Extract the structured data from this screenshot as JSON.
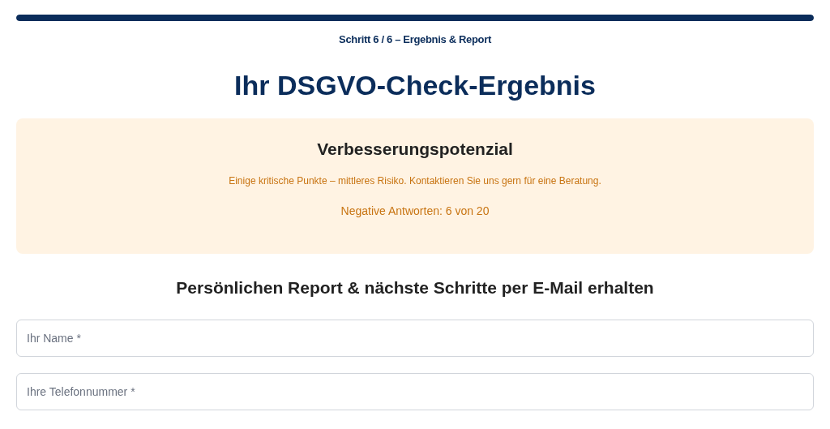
{
  "progress": {
    "level": 1,
    "label": "Schritt 6 / 6 – Ergebnis & Report"
  },
  "title": "Ihr DSGVO-Check-Ergebnis",
  "result": {
    "heading": "Verbesserungspotenzial",
    "message": "Einige kritische Punkte – mittleres Risiko. Kontaktieren Sie uns gern für eine Beratung.",
    "count": "Negative Antworten: 6 von 20"
  },
  "form": {
    "heading": "Persönlichen Report & nächste Schritte per E-Mail erhalten",
    "fields": [
      {
        "placeholder": "Ihr Name *"
      },
      {
        "placeholder": "Ihre Telefonnummer *"
      }
    ]
  }
}
